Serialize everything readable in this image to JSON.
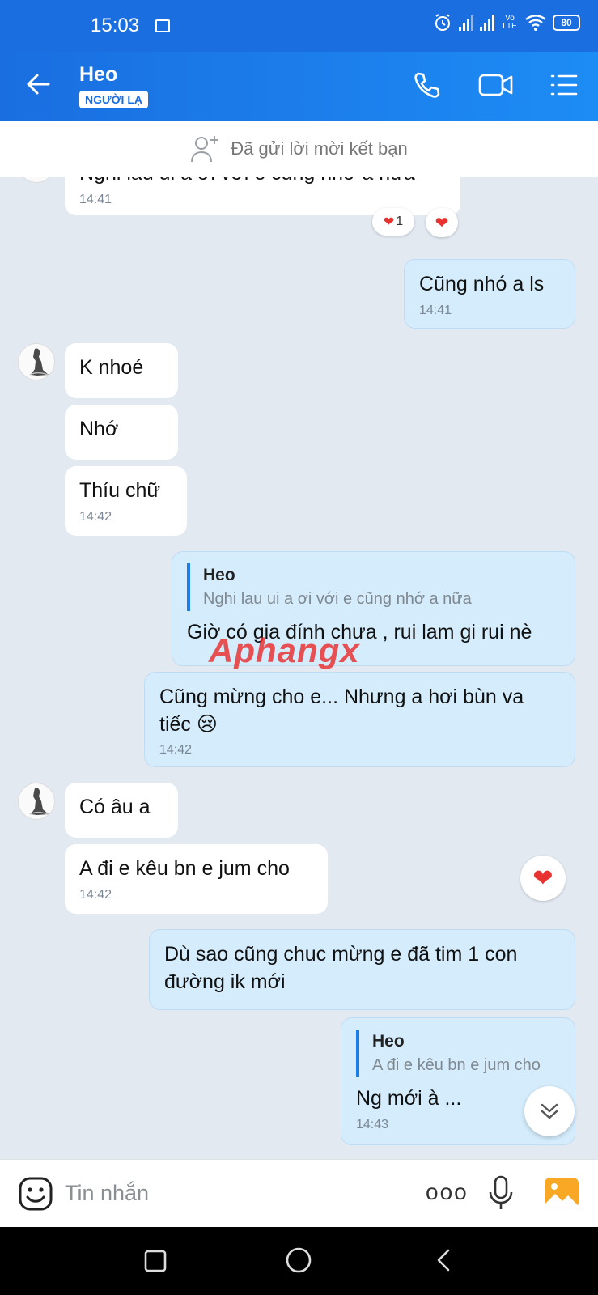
{
  "status_bar": {
    "time": "15:03",
    "battery": "80",
    "network": "Vo LTE"
  },
  "header": {
    "contact_name": "Heo",
    "badge": "NGƯỜI LẠ"
  },
  "friend_request": {
    "text": "Đã gửi lời mời kết bạn"
  },
  "messages": {
    "m0": {
      "text": "Nghi lau ui a ơi với e cũng nhớ a nữa",
      "time": "14:41",
      "reaction_count": "1"
    },
    "m1": {
      "text": "Cũng nhó a ls",
      "time": "14:41"
    },
    "m2": {
      "text": "K nhoé"
    },
    "m3": {
      "text": "Nhớ"
    },
    "m4": {
      "text": "Thíu chữ",
      "time": "14:42"
    },
    "m5": {
      "quote_name": "Heo",
      "quote_text": "Nghi lau ui a ơi với e cũng nhớ a nữa",
      "text": "Giờ có gia đính chưa , rui lam gi rui nè"
    },
    "m6": {
      "text": "Cũng mừng cho e... Nhưng a hơi bùn va tiếc 😢",
      "time": "14:42"
    },
    "m7": {
      "text": "Có âu a"
    },
    "m8": {
      "text": "A đi e kêu bn e jum cho",
      "time": "14:42"
    },
    "m9": {
      "text": "Dù sao cũng chuc mừng e đã tim 1 con đường ik mới"
    },
    "m10": {
      "quote_name": "Heo",
      "quote_text": "A đi e kêu bn e jum cho",
      "text": "Ng mới à ...",
      "time": "14:43"
    }
  },
  "watermark": "Aphangx",
  "input": {
    "placeholder": "Tin nhắn",
    "more_label": "ooo"
  },
  "colors": {
    "header": "#1a6ee0",
    "outgoing_bubble": "#d4ecfc",
    "incoming_bubble": "#ffffff",
    "background": "#e2e9f1",
    "heart": "#e8322f"
  },
  "icons": [
    "image-icon",
    "alarm-icon",
    "signal-icon",
    "wifi-icon",
    "battery-icon",
    "back-arrow-icon",
    "phone-icon",
    "video-call-icon",
    "menu-icon",
    "add-friend-icon",
    "heart-icon",
    "chevron-double-down-icon",
    "emoji-icon",
    "more-icon",
    "mic-icon",
    "gallery-icon",
    "nav-square-icon",
    "nav-circle-icon",
    "nav-back-icon"
  ]
}
